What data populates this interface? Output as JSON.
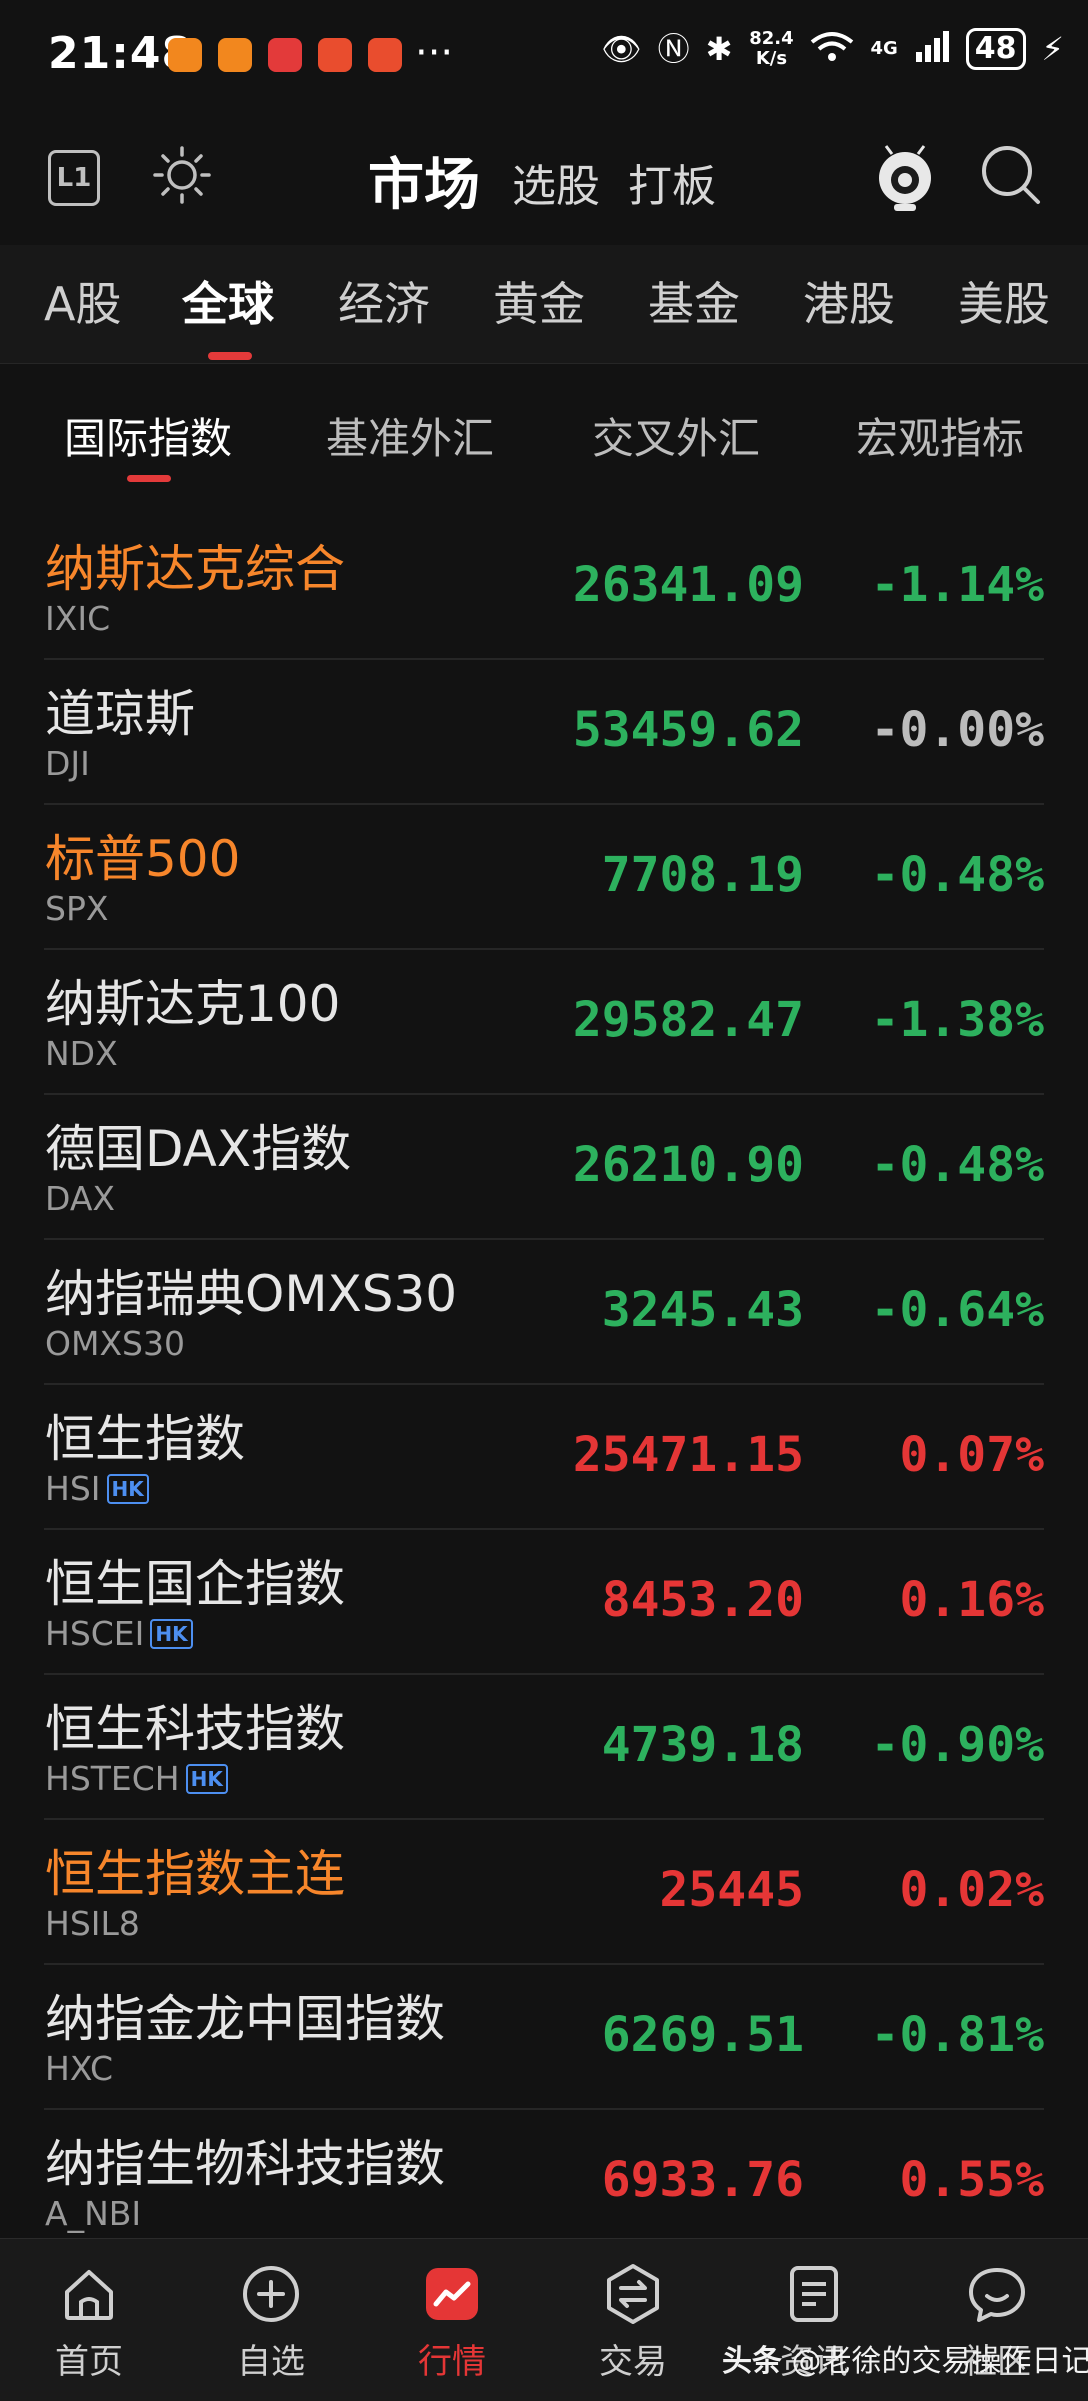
{
  "status_bar": {
    "time": "21:48",
    "more": "···",
    "net_speed": "82.4 K/s",
    "signal": "4G",
    "battery": "48"
  },
  "header": {
    "l1_label": "L1",
    "title": "市场",
    "tab_select": "选股",
    "tab_board": "打板"
  },
  "region_tabs": [
    "A股",
    "全球",
    "经济",
    "黄金",
    "基金",
    "港股",
    "美股"
  ],
  "sub_tabs": [
    "国际指数",
    "基准外汇",
    "交叉外汇",
    "宏观指标"
  ],
  "rows": [
    {
      "name": "纳斯达克综合",
      "code": "IXIC",
      "price": "26341.09",
      "pct": "-1.14%",
      "hk": false,
      "name_color": "orange",
      "trend": "green"
    },
    {
      "name": "道琼斯",
      "code": "DJI",
      "price": "53459.62",
      "pct": "-0.00%",
      "hk": false,
      "name_color": "white",
      "trend": "green",
      "pct_trend": "gray"
    },
    {
      "name": "标普500",
      "code": "SPX",
      "price": "7708.19",
      "pct": "-0.48%",
      "hk": false,
      "name_color": "orange",
      "trend": "green"
    },
    {
      "name": "纳斯达克100",
      "code": "NDX",
      "price": "29582.47",
      "pct": "-1.38%",
      "hk": false,
      "name_color": "white",
      "trend": "green"
    },
    {
      "name": "德国DAX指数",
      "code": "DAX",
      "price": "26210.90",
      "pct": "-0.48%",
      "hk": false,
      "name_color": "white",
      "trend": "green"
    },
    {
      "name": "纳指瑞典OMXS30",
      "code": "OMXS30",
      "price": "3245.43",
      "pct": "-0.64%",
      "hk": false,
      "name_color": "white",
      "trend": "green"
    },
    {
      "name": "恒生指数",
      "code": "HSI",
      "price": "25471.15",
      "pct": "0.07%",
      "hk": true,
      "name_color": "white",
      "trend": "red"
    },
    {
      "name": "恒生国企指数",
      "code": "HSCEI",
      "price": "8453.20",
      "pct": "0.16%",
      "hk": true,
      "name_color": "white",
      "trend": "red"
    },
    {
      "name": "恒生科技指数",
      "code": "HSTECH",
      "price": "4739.18",
      "pct": "-0.90%",
      "hk": true,
      "name_color": "white",
      "trend": "green"
    },
    {
      "name": "恒生指数主连",
      "code": "HSIL8",
      "price": "25445",
      "pct": "0.02%",
      "hk": false,
      "name_color": "orange",
      "trend": "red"
    },
    {
      "name": "纳指金龙中国指数",
      "code": "HXC",
      "price": "6269.51",
      "pct": "-0.81%",
      "hk": false,
      "name_color": "white",
      "trend": "green"
    },
    {
      "name": "纳指生物科技指数",
      "code": "A_NBI",
      "price": "6933.76",
      "pct": "0.55%",
      "hk": false,
      "name_color": "white",
      "trend": "red"
    }
  ],
  "hk_badge": "HK",
  "bottom_nav": [
    {
      "label": "首页",
      "icon": "home-icon"
    },
    {
      "label": "自选",
      "icon": "plus-circle-icon"
    },
    {
      "label": "行情",
      "icon": "market-chart-icon"
    },
    {
      "label": "交易",
      "icon": "exchange-icon"
    },
    {
      "label": "资讯",
      "icon": "document-icon"
    },
    {
      "label": "社区",
      "icon": "chat-icon"
    }
  ],
  "watermark": {
    "brand": "头条",
    "text": "@老徐的交易操作日记"
  },
  "colors": {
    "rise": "#e53636",
    "fall": "#2db15e",
    "accent": "#e33a3a",
    "highlight_name": "#f7862b",
    "flat": "#bcbcbc"
  }
}
